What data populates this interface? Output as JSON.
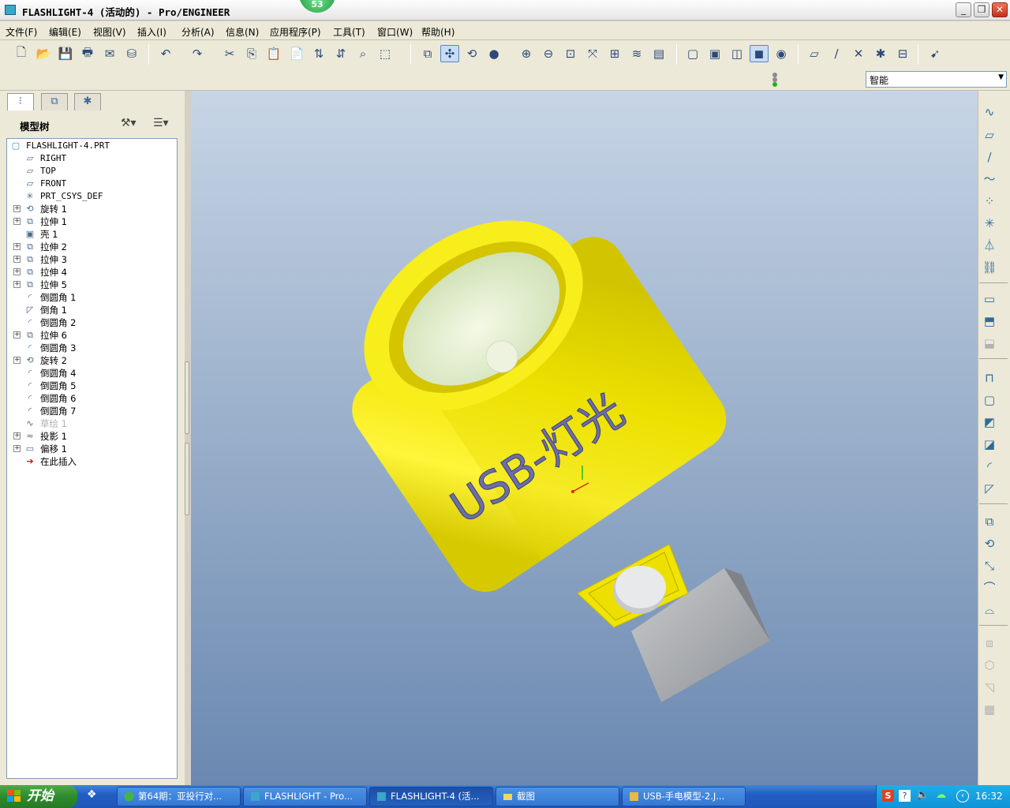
{
  "window": {
    "title": "FLASHLIGHT-4 (活动的) - Pro/ENGINEER",
    "badge": "53"
  },
  "menu": [
    "文件(F)",
    "编辑(E)",
    "视图(V)",
    "插入(I)",
    "分析(A)",
    "信息(N)",
    "应用程序(P)",
    "工具(T)",
    "窗口(W)",
    "帮助(H)"
  ],
  "filter": {
    "value": "智能"
  },
  "model_tree": {
    "title": "模型树",
    "items": [
      {
        "label": "FLASHLIGHT-4.PRT",
        "icon": "part-icon"
      },
      {
        "label": "RIGHT",
        "icon": "datum-plane-icon"
      },
      {
        "label": "TOP",
        "icon": "datum-plane-icon"
      },
      {
        "label": "FRONT",
        "icon": "datum-plane-icon"
      },
      {
        "label": "PRT_CSYS_DEF",
        "icon": "csys-icon"
      },
      {
        "label": "旋转 1",
        "icon": "revolve-icon"
      },
      {
        "label": "拉伸 1",
        "icon": "extrude-icon"
      },
      {
        "label": "壳 1",
        "icon": "shell-icon"
      },
      {
        "label": "拉伸 2",
        "icon": "extrude-icon"
      },
      {
        "label": "拉伸 3",
        "icon": "extrude-icon"
      },
      {
        "label": "拉伸 4",
        "icon": "extrude-icon"
      },
      {
        "label": "拉伸 5",
        "icon": "extrude-icon"
      },
      {
        "label": "倒圆角 1",
        "icon": "round-icon"
      },
      {
        "label": "倒角 1",
        "icon": "chamfer-icon"
      },
      {
        "label": "倒圆角 2",
        "icon": "round-icon"
      },
      {
        "label": "拉伸 6",
        "icon": "extrude-icon"
      },
      {
        "label": "倒圆角 3",
        "icon": "round-icon"
      },
      {
        "label": "旋转 2",
        "icon": "revolve-icon"
      },
      {
        "label": "倒圆角 4",
        "icon": "round-icon"
      },
      {
        "label": "倒圆角 5",
        "icon": "round-icon"
      },
      {
        "label": "倒圆角 6",
        "icon": "round-icon"
      },
      {
        "label": "倒圆角 7",
        "icon": "round-icon"
      },
      {
        "label": "草绘 1",
        "icon": "sketch-icon"
      },
      {
        "label": "投影 1",
        "icon": "projection-icon"
      },
      {
        "label": "偏移 1",
        "icon": "offset-icon"
      },
      {
        "label": "在此插入",
        "icon": "insert-here-icon"
      }
    ]
  },
  "model": {
    "text": "USB-灯光",
    "body_color": "#f2e600",
    "lens_color": "#e4f0c8",
    "connector_color": "#b9bcbf"
  },
  "taskbar": {
    "start_label": "开始",
    "tasks": [
      "第64期：亚投行对...",
      "FLASHLIGHT - Pro...",
      "FLASHLIGHT-4 (活...",
      "截图",
      "USB-手电模型-2.J..."
    ],
    "clock": "16:32"
  }
}
